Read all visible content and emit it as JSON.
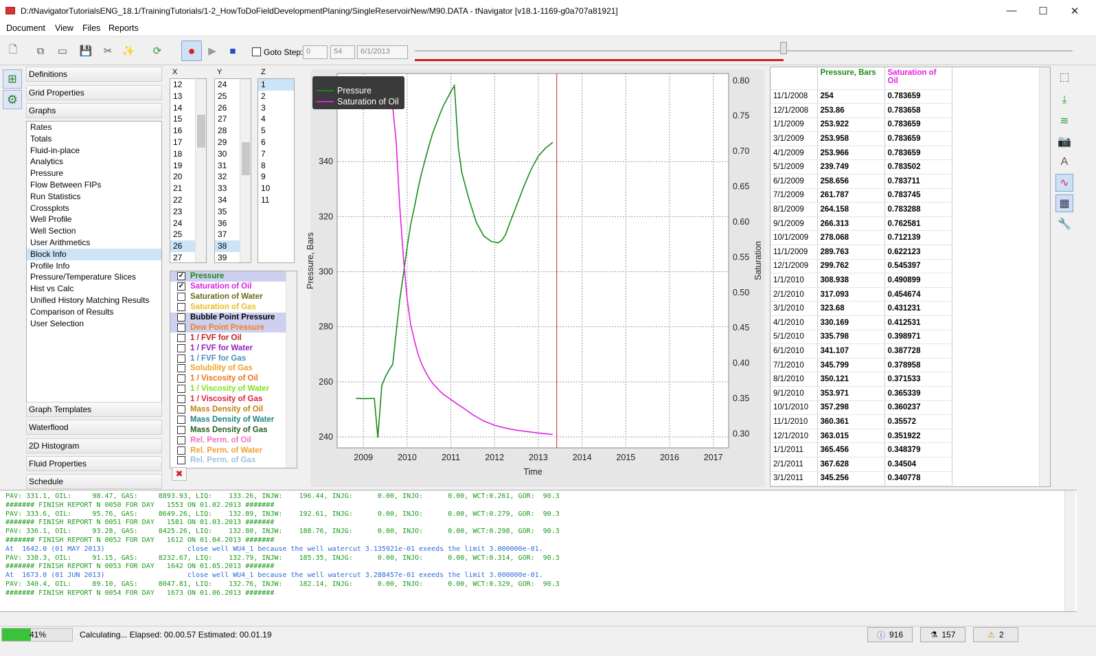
{
  "window": {
    "title": "D:/tNavigatorTutorialsENG_18.1/TrainingTutorials/1-2_HowToDoFieldDevelopmentPlaning/SingleReservoirNew/M90.DATA - tNavigator [v18.1-1169-g0a707a81921]",
    "minimize": "—",
    "maximize": "☐",
    "close": "✕"
  },
  "menu": [
    "Document",
    "View",
    "Files",
    "Reports"
  ],
  "toolbar": {
    "goto_step_label": "Goto Step:",
    "step_value": "0",
    "step_max": "54",
    "date_value": "6/1/2013"
  },
  "nav": {
    "top": [
      "Definitions",
      "Grid Properties",
      "Graphs"
    ],
    "graphs": [
      "Rates",
      "Totals",
      "Fluid-in-place",
      "Analytics",
      "Pressure",
      "Flow Between FIPs",
      "Run Statistics",
      "Crossplots",
      "Well Profile",
      "Well Section",
      "User Arithmetics",
      "Block Info",
      "Profile Info",
      "Pressure/Temperature Slices",
      "Hist vs Calc",
      "Unified History Matching Results",
      "Comparison of Results",
      "User Selection"
    ],
    "selected_graph": "Block Info",
    "bottom": [
      "Graph Templates",
      "Waterflood",
      "2D Histogram",
      "Fluid Properties",
      "Schedule"
    ]
  },
  "xyz": {
    "x_label": "X",
    "y_label": "Y",
    "z_label": "Z",
    "x": [
      "12",
      "13",
      "14",
      "15",
      "16",
      "17",
      "18",
      "19",
      "20",
      "21",
      "22",
      "23",
      "24",
      "25",
      "26",
      "27"
    ],
    "y": [
      "24",
      "25",
      "26",
      "27",
      "28",
      "29",
      "30",
      "31",
      "32",
      "33",
      "34",
      "35",
      "36",
      "37",
      "38",
      "39"
    ],
    "z": [
      "1",
      "2",
      "3",
      "4",
      "5",
      "6",
      "7",
      "8",
      "9",
      "10",
      "11"
    ],
    "x_sel": "26",
    "y_sel": "38",
    "z_sel": "1"
  },
  "properties": [
    {
      "label": "Pressure",
      "color": "#1a8a1a",
      "checked": true,
      "hl": true
    },
    {
      "label": "Saturation of Oil",
      "color": "#e020e0",
      "checked": true,
      "hl": false
    },
    {
      "label": "Saturation of Water",
      "color": "#6a6a1a",
      "checked": false,
      "hl": false
    },
    {
      "label": "Saturation of Gas",
      "color": "#e8c020",
      "checked": false,
      "hl": false
    },
    {
      "label": "Bubble Point Pressure",
      "color": "#000000",
      "checked": false,
      "hl": true
    },
    {
      "label": "Dew Point Pressure",
      "color": "#f08020",
      "checked": false,
      "hl": true
    },
    {
      "label": "1 / FVF for Oil",
      "color": "#c02020",
      "checked": false,
      "hl": false
    },
    {
      "label": "1 / FVF for Water",
      "color": "#9020c0",
      "checked": false,
      "hl": false
    },
    {
      "label": "1 / FVF for Gas",
      "color": "#4a90b8",
      "checked": false,
      "hl": false
    },
    {
      "label": "Solubility of Gas",
      "color": "#f0a020",
      "checked": false,
      "hl": false
    },
    {
      "label": "1 / Viscosity of Oil",
      "color": "#f07020",
      "checked": false,
      "hl": false
    },
    {
      "label": "1 / Viscosity of Water",
      "color": "#80e020",
      "checked": false,
      "hl": false
    },
    {
      "label": "1 / Viscosity of Gas",
      "color": "#e02040",
      "checked": false,
      "hl": false
    },
    {
      "label": "Mass Density of Oil",
      "color": "#c08010",
      "checked": false,
      "hl": false
    },
    {
      "label": "Mass Density of Water",
      "color": "#208080",
      "checked": false,
      "hl": false
    },
    {
      "label": "Mass Density of Gas",
      "color": "#206020",
      "checked": false,
      "hl": false
    },
    {
      "label": "Rel. Perm. of Oil",
      "color": "#f070c0",
      "checked": false,
      "hl": false
    },
    {
      "label": "Rel. Perm. of Water",
      "color": "#f0a030",
      "checked": false,
      "hl": false
    },
    {
      "label": "Rel. Perm. of Gas",
      "color": "#a0c0e0",
      "checked": false,
      "hl": false
    }
  ],
  "delete_icon": "✖",
  "chart_data": {
    "type": "line",
    "xlabel": "Time",
    "ylabel": "Pressure, Bars",
    "y2label": "Saturation",
    "xlim": [
      2008.4,
      2017.35
    ],
    "ylim": [
      236,
      372
    ],
    "y2lim": [
      0.28,
      0.81
    ],
    "x_ticks": [
      "2009",
      "2010",
      "2011",
      "2012",
      "2013",
      "2014",
      "2015",
      "2016",
      "2017"
    ],
    "y_ticks": [
      "240",
      "260",
      "280",
      "300",
      "320",
      "340"
    ],
    "y2_ticks": [
      "0.30",
      "0.35",
      "0.40",
      "0.45",
      "0.50",
      "0.55",
      "0.60",
      "0.65",
      "0.70",
      "0.75",
      "0.80"
    ],
    "current_time": 2013.42,
    "legend_position": "top-left",
    "series": [
      {
        "name": "Pressure",
        "color": "#1a8a1a",
        "axis": "left",
        "x": [
          2008.83,
          2009.0,
          2009.08,
          2009.17,
          2009.25,
          2009.33,
          2009.42,
          2009.5,
          2009.58,
          2009.67,
          2009.75,
          2009.83,
          2009.92,
          2010.0,
          2010.08,
          2010.17,
          2010.25,
          2010.33,
          2010.42,
          2010.5,
          2010.58,
          2010.67,
          2010.75,
          2010.83,
          2010.92,
          2011.0,
          2011.08,
          2011.17,
          2011.25,
          2011.42,
          2011.58,
          2011.75,
          2011.92,
          2012.08,
          2012.17,
          2012.25,
          2012.33,
          2012.5,
          2012.67,
          2012.83,
          2013.0,
          2013.17,
          2013.33
        ],
        "y": [
          254,
          253.86,
          253.92,
          253.96,
          253.97,
          239.75,
          258.66,
          261.79,
          264.16,
          266.31,
          278.07,
          289.76,
          299.76,
          308.94,
          317.09,
          323.68,
          330.17,
          335.8,
          341.11,
          345.8,
          350.12,
          353.97,
          357.3,
          360.36,
          363.02,
          365.46,
          367.63,
          345.26,
          336,
          326,
          318,
          313,
          311,
          310.5,
          311.5,
          313.5,
          317,
          324,
          331,
          337,
          342,
          345,
          347
        ]
      },
      {
        "name": "Saturation of Oil",
        "color": "#e020e0",
        "axis": "right",
        "x": [
          2009.67,
          2009.75,
          2009.83,
          2009.92,
          2010.0,
          2010.08,
          2010.17,
          2010.25,
          2010.33,
          2010.42,
          2010.5,
          2010.58,
          2010.67,
          2010.75,
          2010.83,
          2010.92,
          2011.0,
          2011.08,
          2011.17,
          2011.25,
          2011.5,
          2011.75,
          2012.0,
          2012.25,
          2012.5,
          2012.75,
          2013.0,
          2013.25,
          2013.33
        ],
        "y": [
          0.7625,
          0.7121,
          0.6221,
          0.5454,
          0.4909,
          0.4547,
          0.4312,
          0.4125,
          0.399,
          0.3877,
          0.379,
          0.3715,
          0.3657,
          0.3602,
          0.3557,
          0.3519,
          0.3484,
          0.345,
          0.341,
          0.338,
          0.327,
          0.318,
          0.312,
          0.308,
          0.305,
          0.303,
          0.301,
          0.2995,
          0.299
        ]
      }
    ]
  },
  "table": {
    "headers": [
      "",
      "Pressure, Bars",
      "Saturation of Oil"
    ],
    "rows": [
      [
        "11/1/2008",
        "254",
        "0.783659"
      ],
      [
        "12/1/2008",
        "253.86",
        "0.783658"
      ],
      [
        "1/1/2009",
        "253.922",
        "0.783659"
      ],
      [
        "3/1/2009",
        "253.958",
        "0.783659"
      ],
      [
        "4/1/2009",
        "253.966",
        "0.783659"
      ],
      [
        "5/1/2009",
        "239.749",
        "0.783502"
      ],
      [
        "6/1/2009",
        "258.656",
        "0.783711"
      ],
      [
        "7/1/2009",
        "261.787",
        "0.783745"
      ],
      [
        "8/1/2009",
        "264.158",
        "0.783288"
      ],
      [
        "9/1/2009",
        "266.313",
        "0.762581"
      ],
      [
        "10/1/2009",
        "278.068",
        "0.712139"
      ],
      [
        "11/1/2009",
        "289.763",
        "0.622123"
      ],
      [
        "12/1/2009",
        "299.762",
        "0.545397"
      ],
      [
        "1/1/2010",
        "308.938",
        "0.490899"
      ],
      [
        "2/1/2010",
        "317.093",
        "0.454674"
      ],
      [
        "3/1/2010",
        "323.68",
        "0.431231"
      ],
      [
        "4/1/2010",
        "330.169",
        "0.412531"
      ],
      [
        "5/1/2010",
        "335.798",
        "0.398971"
      ],
      [
        "6/1/2010",
        "341.107",
        "0.387728"
      ],
      [
        "7/1/2010",
        "345.799",
        "0.378958"
      ],
      [
        "8/1/2010",
        "350.121",
        "0.371533"
      ],
      [
        "9/1/2010",
        "353.971",
        "0.365339"
      ],
      [
        "10/1/2010",
        "357.298",
        "0.360237"
      ],
      [
        "11/1/2010",
        "360.361",
        "0.35572"
      ],
      [
        "12/1/2010",
        "363.015",
        "0.351922"
      ],
      [
        "1/1/2011",
        "365.456",
        "0.348379"
      ],
      [
        "2/1/2011",
        "367.628",
        "0.34504"
      ],
      [
        "3/1/2011",
        "345.256",
        "0.340778"
      ]
    ]
  },
  "log": [
    {
      "t": "PAV: 331.1, OIL:     98.47, GAS:     8893.93, LIQ:    133.26, INJW:    196.44, INJG:      0.00, INJO:      0.00, WCT:0.261, GOR:  90.3",
      "c": "lg"
    },
    {
      "t": "####### FINISH REPORT N 0050 FOR DAY   1553 ON 01.02.2013 #######",
      "c": "lg"
    },
    {
      "t": "PAV: 333.6, OIL:     95.76, GAS:     8649.26, LIQ:    132.89, INJW:    192.61, INJG:      0.00, INJO:      0.00, WCT:0.279, GOR:  90.3",
      "c": "lg"
    },
    {
      "t": "####### FINISH REPORT N 0051 FOR DAY   1581 ON 01.03.2013 #######",
      "c": "lg"
    },
    {
      "t": "PAV: 336.1, OIL:     93.28, GAS:     8425.26, LIQ:    132.80, INJW:    188.76, INJG:      0.00, INJO:      0.00, WCT:0.298, GOR:  90.3",
      "c": "lg"
    },
    {
      "t": "####### FINISH REPORT N 0052 FOR DAY   1612 ON 01.04.2013 #######",
      "c": "lg"
    },
    {
      "t": "At  1642.0 (01 MAY 2013)                    close well WU4_1 because the well watercut 3.135921e-01 exeeds the limit 3.000000e-01.",
      "c": "lb"
    },
    {
      "t": "PAV: 338.3, OIL:     91.15, GAS:     8232.67, LIQ:    132.79, INJW:    185.35, INJG:      0.00, INJO:      0.00, WCT:0.314, GOR:  90.3",
      "c": "lg"
    },
    {
      "t": "####### FINISH REPORT N 0053 FOR DAY   1642 ON 01.05.2013 #######",
      "c": "lg"
    },
    {
      "t": "At  1673.0 (01 JUN 2013)                    close well WU4_1 because the well watercut 3.288457e-01 exeeds the limit 3.000000e-01.",
      "c": "lb"
    },
    {
      "t": "PAV: 340.4, OIL:     89.10, GAS:     8047.81, LIQ:    132.76, INJW:    182.14, INJG:      0.00, INJO:      0.00, WCT:0.329, GOR:  90.3",
      "c": "lg"
    },
    {
      "t": "####### FINISH REPORT N 0054 FOR DAY   1673 ON 01.06.2013 #######",
      "c": "lg"
    }
  ],
  "status": {
    "progress_label": "41%",
    "progress_value": 0.41,
    "message": "Calculating... Elapsed: 00.00.57 Estimated: 00.01.19",
    "info_count": "916",
    "flask_count": "157",
    "warn_count": "2"
  }
}
